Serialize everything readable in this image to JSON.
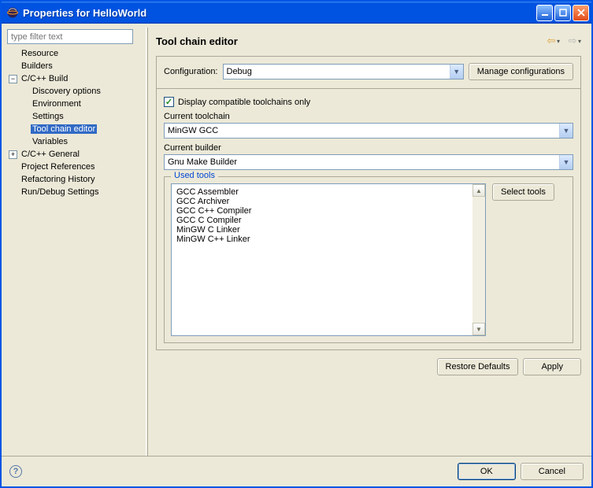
{
  "titlebar": {
    "title": "Properties for HelloWorld"
  },
  "filter": {
    "placeholder": "type filter text"
  },
  "tree": {
    "n0": "Resource",
    "n1": "Builders",
    "n2": "C/C++ Build",
    "n2_0": "Discovery options",
    "n2_1": "Environment",
    "n2_2": "Settings",
    "n2_3": "Tool chain editor",
    "n2_4": "Variables",
    "n3": "C/C++ General",
    "n4": "Project References",
    "n5": "Refactoring History",
    "n6": "Run/Debug Settings"
  },
  "page": {
    "title": "Tool chain editor"
  },
  "config": {
    "label": "Configuration:",
    "value": "Debug",
    "manage": "Manage configurations"
  },
  "compat": {
    "label": "Display compatible toolchains only"
  },
  "toolchain": {
    "label": "Current toolchain",
    "value": "MinGW GCC"
  },
  "builder": {
    "label": "Current builder",
    "value": "Gnu Make Builder"
  },
  "used": {
    "legend": "Used tools",
    "t0": "GCC Assembler",
    "t1": "GCC Archiver",
    "t2": "GCC C++ Compiler",
    "t3": "GCC C Compiler",
    "t4": "MinGW C Linker",
    "t5": "MinGW C++ Linker",
    "select_btn": "Select tools"
  },
  "bottom": {
    "restore": "Restore Defaults",
    "apply": "Apply"
  },
  "footer": {
    "ok": "OK",
    "cancel": "Cancel"
  }
}
